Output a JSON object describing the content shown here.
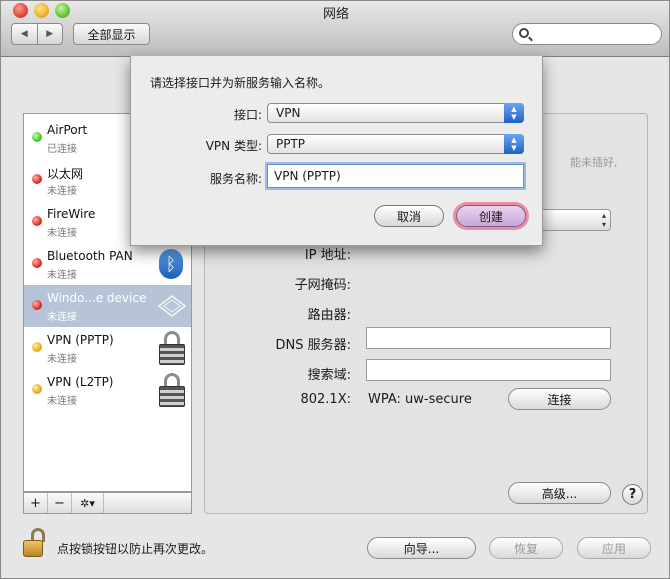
{
  "window": {
    "title": "网络"
  },
  "toolbar": {
    "back_glyph": "◀",
    "forward_glyph": "▶",
    "show_all_label": "全部显示",
    "search_placeholder": ""
  },
  "sidebar": {
    "services": [
      {
        "name": "AirPort",
        "status": "已连接",
        "dot": "green"
      },
      {
        "name": "以太网",
        "status": "未连接",
        "dot": "red"
      },
      {
        "name": "FireWire",
        "status": "未连接",
        "dot": "red"
      },
      {
        "name": "Bluetooth PAN",
        "status": "未连接",
        "dot": "red",
        "icon": "bluetooth-icon"
      },
      {
        "name": "Windo...e device",
        "status": "未连接",
        "dot": "red",
        "icon": "network-adapter-icon",
        "selected": true
      },
      {
        "name": "VPN (PPTP)",
        "status": "未连接",
        "dot": "yellow",
        "icon": "lock-icon"
      },
      {
        "name": "VPN (L2TP)",
        "status": "未连接",
        "dot": "yellow",
        "icon": "lock-icon"
      }
    ],
    "add_label": "+",
    "remove_label": "−",
    "action_label": "✲▾"
  },
  "detail": {
    "partial_status_text": "能未插好,",
    "ip_label": "IP 地址:",
    "subnet_label": "子网掩码:",
    "router_label": "路由器:",
    "dns_label": "DNS 服务器:",
    "dns_value": "",
    "search_domain_label": "搜索域:",
    "search_domain_value": "",
    "dot1x_label": "802.1X:",
    "dot1x_value": "WPA: uw-secure",
    "connect_label": "连接",
    "advanced_label": "高级...",
    "help_label": "?"
  },
  "footer": {
    "lock_text": "点按锁按钮以防止再次更改。",
    "assist_label": "向导...",
    "revert_label": "恢复",
    "apply_label": "应用"
  },
  "sheet": {
    "prompt": "请选择接口并为新服务输入名称。",
    "interface_label": "接口:",
    "interface_value": "VPN",
    "vpn_type_label": "VPN 类型:",
    "vpn_type_value": "PPTP",
    "service_name_label": "服务名称:",
    "service_name_value": "VPN (PPTP)",
    "cancel_label": "取消",
    "create_label": "创建"
  },
  "colors": {
    "selection": "#b7c4d8",
    "default_button_glow": "#e88fa3",
    "popup_arrow_blue": "#1f62c4"
  }
}
